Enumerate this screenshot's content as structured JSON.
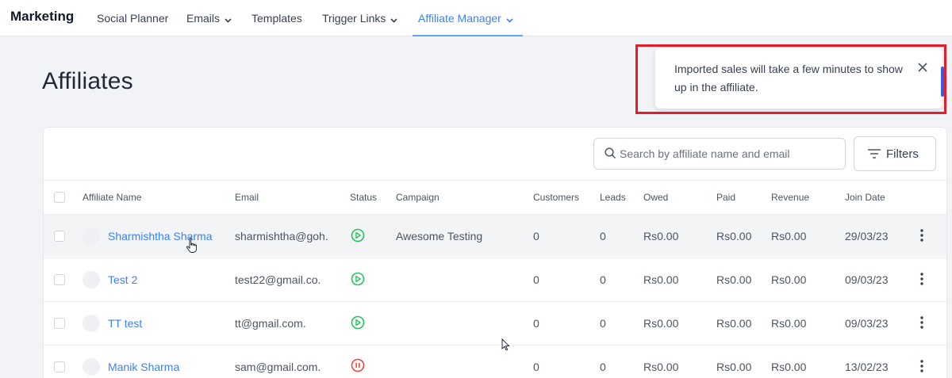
{
  "nav": {
    "brand": "Marketing",
    "items": [
      {
        "label": "Social Planner",
        "dropdown": false,
        "active": false
      },
      {
        "label": "Emails",
        "dropdown": true,
        "active": false
      },
      {
        "label": "Templates",
        "dropdown": false,
        "active": false
      },
      {
        "label": "Trigger Links",
        "dropdown": true,
        "active": false
      },
      {
        "label": "Affiliate Manager",
        "dropdown": true,
        "active": true
      }
    ]
  },
  "page": {
    "title": "Affiliates"
  },
  "search": {
    "placeholder": "Search by affiliate name and email",
    "value": ""
  },
  "filters": {
    "label": "Filters"
  },
  "table": {
    "columns": [
      "Affiliate Name",
      "Email",
      "Status",
      "Campaign",
      "Customers",
      "Leads",
      "Owed",
      "Paid",
      "Revenue",
      "Join Date"
    ],
    "rows": [
      {
        "name": "Sharmishtha Sharma",
        "email": "sharmishtha@goh.",
        "status": "active",
        "campaign": "Awesome Testing",
        "customers": "0",
        "leads": "0",
        "owed": "Rs0.00",
        "paid": "Rs0.00",
        "revenue": "Rs0.00",
        "join_date": "29/03/23"
      },
      {
        "name": "Test 2",
        "email": "test22@gmail.co.",
        "status": "active",
        "campaign": "",
        "customers": "0",
        "leads": "0",
        "owed": "Rs0.00",
        "paid": "Rs0.00",
        "revenue": "Rs0.00",
        "join_date": "09/03/23"
      },
      {
        "name": "TT test",
        "email": "tt@gmail.com.",
        "status": "active",
        "campaign": "",
        "customers": "0",
        "leads": "0",
        "owed": "Rs0.00",
        "paid": "Rs0.00",
        "revenue": "Rs0.00",
        "join_date": "09/03/23"
      },
      {
        "name": "Manik Sharma",
        "email": "sam@gmail.com.",
        "status": "paused",
        "campaign": "",
        "customers": "0",
        "leads": "0",
        "owed": "Rs0.00",
        "paid": "Rs0.00",
        "revenue": "Rs0.00",
        "join_date": "13/02/23"
      }
    ]
  },
  "toast": {
    "message": "Imported sales will take a few minutes to show up in the affiliate."
  },
  "colors": {
    "accent": "#3b82f6",
    "active_status": "#22c55e",
    "paused_status": "#ef4444",
    "highlight_frame": "#e11d2a"
  },
  "icons": {
    "search": "search-icon",
    "filters": "filter-lines-icon",
    "close": "close-icon",
    "chevron": "chevron-down-icon",
    "kebab": "kebab-menu-icon",
    "play": "play-circle-icon",
    "pause": "pause-circle-icon"
  }
}
